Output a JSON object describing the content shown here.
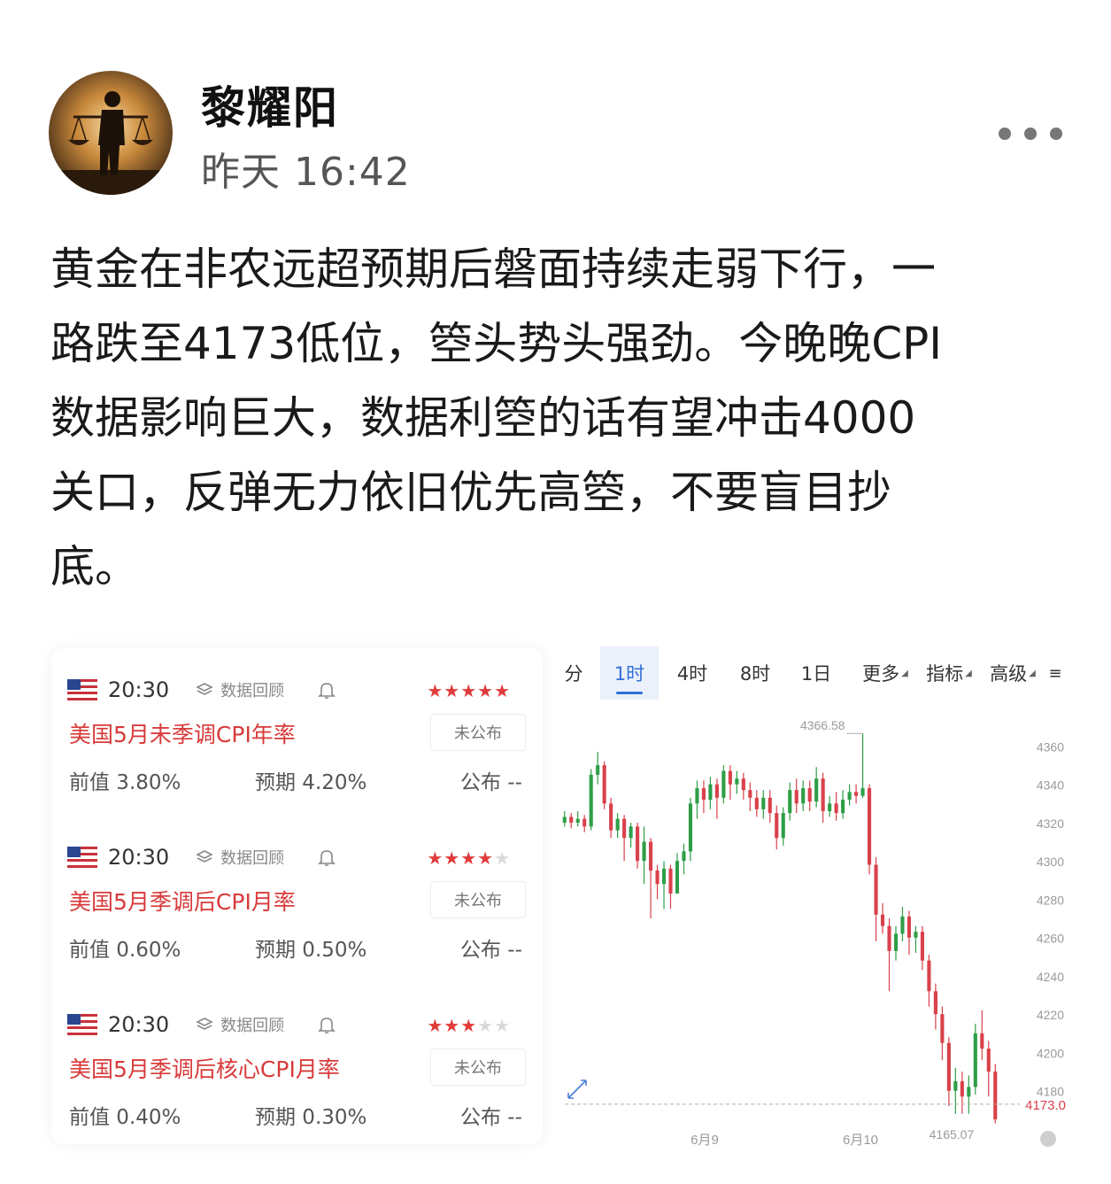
{
  "post": {
    "author": "黎耀阳",
    "time": "昨天 16:42",
    "lines": [
      "黄金在非农远超预期后磐面持续走弱下行，一",
      "路跌至4173低位，箜头势头强劲。今晚晚CPI",
      "数据影响巨大，数据利箜的话有望冲击4000",
      "关口，反弹无力依旧优先高箜，不要盲目抄",
      "底。"
    ],
    "more_icon": "more-dots-icon"
  },
  "calendar": {
    "events": [
      {
        "time": "20:30",
        "review_label": "数据回顾",
        "stars": 5,
        "title": "美国5月未季调CPI年率",
        "status": "未公布",
        "prev": "前值 3.80%",
        "expected": "预期 4.20%",
        "published": "公布 --"
      },
      {
        "time": "20:30",
        "review_label": "数据回顾",
        "stars": 4,
        "title": "美国5月季调后CPI月率",
        "status": "未公布",
        "prev": "前值 0.60%",
        "expected": "预期 0.50%",
        "published": "公布 --"
      },
      {
        "time": "20:30",
        "review_label": "数据回顾",
        "stars": 3,
        "title": "美国5月季调后核心CPI月率",
        "status": "未公布",
        "prev": "前值 0.40%",
        "expected": "预期 0.30%",
        "published": "公布 --"
      }
    ],
    "star_color": "#e03b3b",
    "title_color": "#d83a3a"
  },
  "kline": {
    "tabs": [
      "分",
      "1时",
      "4时",
      "8时",
      "1日",
      "更多",
      "指标",
      "高级"
    ],
    "active_tab": "1时",
    "high_label": "4366.58",
    "low_label": "4165.07",
    "current_price": "4173.0",
    "x_labels": [
      "6月9",
      "6月10"
    ],
    "colors": {
      "up": "#2e9e47",
      "down": "#d9414b"
    }
  },
  "chart_data": {
    "type": "candlestick",
    "y_ticks": [
      4180,
      4200,
      4220,
      4240,
      4260,
      4280,
      4300,
      4320,
      4340,
      4360
    ],
    "ylim": [
      4160,
      4375
    ],
    "x_labels": [
      "6月9",
      "6月10"
    ],
    "high": 4366.58,
    "low": 4165.07,
    "last": 4173.0,
    "candles": [
      [
        4320,
        4323,
        4326,
        4318
      ],
      [
        4323,
        4320,
        4325,
        4317
      ],
      [
        4320,
        4322,
        4326,
        4318
      ],
      [
        4322,
        4318,
        4324,
        4315
      ],
      [
        4318,
        4345,
        4348,
        4316
      ],
      [
        4345,
        4350,
        4357,
        4340
      ],
      [
        4350,
        4330,
        4352,
        4327
      ],
      [
        4330,
        4316,
        4333,
        4312
      ],
      [
        4316,
        4322,
        4325,
        4312
      ],
      [
        4322,
        4312,
        4324,
        4300
      ],
      [
        4312,
        4318,
        4320,
        4307
      ],
      [
        4318,
        4300,
        4320,
        4296
      ],
      [
        4300,
        4310,
        4318,
        4288
      ],
      [
        4310,
        4295,
        4312,
        4270
      ],
      [
        4295,
        4288,
        4298,
        4280
      ],
      [
        4288,
        4296,
        4300,
        4275
      ],
      [
        4296,
        4283,
        4298,
        4275
      ],
      [
        4283,
        4300,
        4304,
        4283
      ],
      [
        4300,
        4305,
        4309,
        4293
      ],
      [
        4305,
        4330,
        4333,
        4300
      ],
      [
        4330,
        4338,
        4342,
        4322
      ],
      [
        4338,
        4332,
        4342,
        4325
      ],
      [
        4332,
        4340,
        4344,
        4327
      ],
      [
        4340,
        4333,
        4343,
        4322
      ],
      [
        4333,
        4347,
        4350,
        4330
      ],
      [
        4347,
        4340,
        4350,
        4332
      ],
      [
        4340,
        4343,
        4347,
        4335
      ],
      [
        4343,
        4337,
        4346,
        4332
      ],
      [
        4337,
        4333,
        4341,
        4326
      ],
      [
        4333,
        4327,
        4337,
        4323
      ],
      [
        4327,
        4333,
        4337,
        4322
      ],
      [
        4333,
        4325,
        4337,
        4320
      ],
      [
        4325,
        4312,
        4329,
        4306
      ],
      [
        4312,
        4325,
        4328,
        4308
      ],
      [
        4325,
        4337,
        4341,
        4321
      ],
      [
        4337,
        4330,
        4343,
        4325
      ],
      [
        4330,
        4338,
        4342,
        4326
      ],
      [
        4338,
        4331,
        4342,
        4326
      ],
      [
        4331,
        4343,
        4349,
        4328
      ],
      [
        4343,
        4326,
        4346,
        4320
      ],
      [
        4326,
        4330,
        4334,
        4323
      ],
      [
        4330,
        4325,
        4336,
        4321
      ],
      [
        4325,
        4332,
        4337,
        4322
      ],
      [
        4332,
        4336,
        4340,
        4329
      ],
      [
        4336,
        4334,
        4340,
        4330
      ],
      [
        4334,
        4338,
        4366.58,
        4333
      ],
      [
        4338,
        4298,
        4340,
        4293
      ],
      [
        4298,
        4272,
        4302,
        4258
      ],
      [
        4272,
        4266,
        4278,
        4262
      ],
      [
        4266,
        4253,
        4270,
        4232
      ],
      [
        4253,
        4262,
        4266,
        4248
      ],
      [
        4262,
        4271,
        4276,
        4258
      ],
      [
        4271,
        4260,
        4274,
        4251
      ],
      [
        4260,
        4263,
        4266,
        4252
      ],
      [
        4263,
        4248,
        4266,
        4243
      ],
      [
        4248,
        4232,
        4251,
        4224
      ],
      [
        4232,
        4220,
        4236,
        4212
      ],
      [
        4220,
        4205,
        4224,
        4196
      ],
      [
        4205,
        4180,
        4208,
        4172
      ],
      [
        4180,
        4185,
        4192,
        4168
      ],
      [
        4185,
        4177,
        4190,
        4168
      ],
      [
        4177,
        4182,
        4188,
        4168
      ],
      [
        4182,
        4210,
        4215,
        4178
      ],
      [
        4210,
        4202,
        4222,
        4196
      ],
      [
        4202,
        4190,
        4206,
        4177
      ],
      [
        4190,
        4165.07,
        4194,
        4163
      ]
    ]
  }
}
